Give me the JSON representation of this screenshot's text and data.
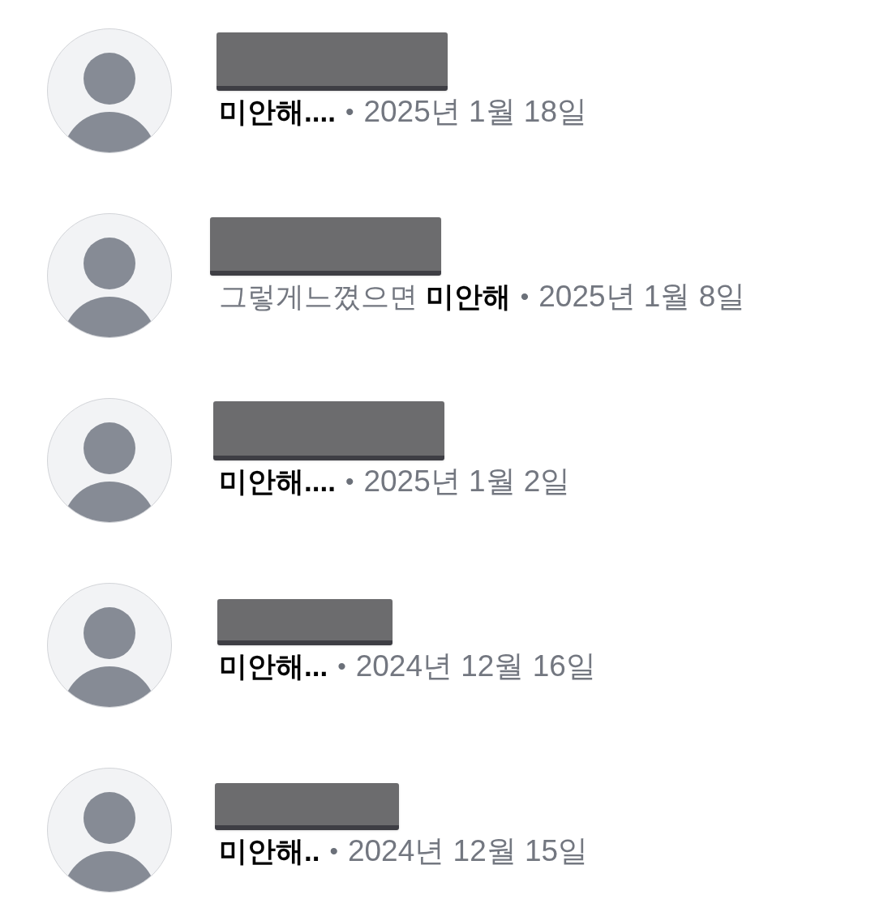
{
  "conversations": [
    {
      "message": "미안해....",
      "highlighted": true,
      "separator": "•",
      "date": "2025년 1월 18일"
    },
    {
      "message": "그렇게느꼈으면 **미안해**",
      "highlighted": false,
      "separator": "•",
      "date": "2025년 1월 8일"
    },
    {
      "message": "미안해....",
      "highlighted": true,
      "separator": "•",
      "date": "2025년 1월 2일"
    },
    {
      "message": "미안해...",
      "highlighted": true,
      "separator": "•",
      "date": "2024년 12월 16일"
    },
    {
      "message": "미안해..",
      "highlighted": true,
      "separator": "•",
      "date": "2024년 12월 15일"
    }
  ]
}
